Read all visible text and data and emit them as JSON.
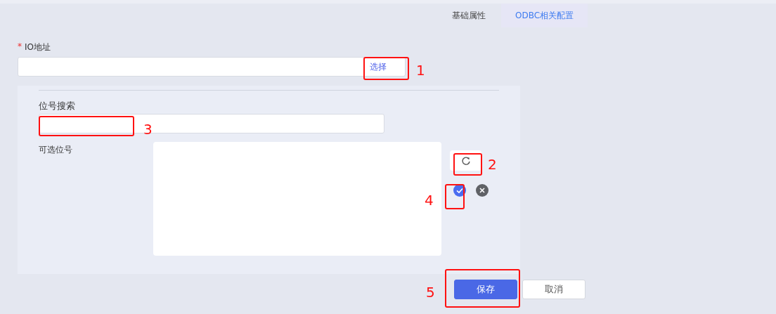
{
  "tabs": [
    {
      "label": "基础属性",
      "selected": false
    },
    {
      "label": "ODBC相关配置",
      "selected": true
    }
  ],
  "io_address": {
    "required_mark": "*",
    "label": "IO地址",
    "button": "选择"
  },
  "tag_search": {
    "label": "位号搜索"
  },
  "available_tags": {
    "label": "可选位号"
  },
  "buttons": [
    {
      "label": "保存",
      "kind": "primary"
    },
    {
      "label": "取消",
      "kind": "default"
    }
  ],
  "annotations": [
    {
      "label": "1"
    },
    {
      "label": "2"
    },
    {
      "label": "3"
    },
    {
      "label": "4"
    },
    {
      "label": "5"
    }
  ]
}
